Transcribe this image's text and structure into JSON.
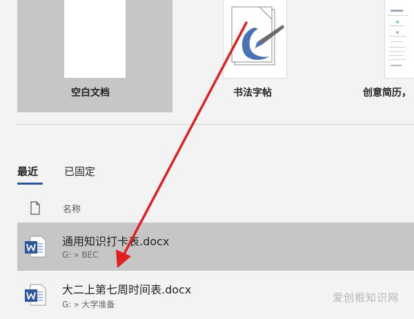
{
  "templates": {
    "blank": {
      "label": "空白文档"
    },
    "calligraphy": {
      "label": "书法字帖"
    },
    "resume": {
      "label": "创意简历，"
    }
  },
  "tabs": [
    {
      "label": "最近",
      "active": true
    },
    {
      "label": "已固定",
      "active": false
    }
  ],
  "file_list": {
    "column_name": "名称",
    "files": [
      {
        "name": "通用知识打卡表.docx",
        "path": "G: » BEC",
        "selected": true,
        "icon": "word-doc-icon"
      },
      {
        "name": "大二上第七周时间表.docx",
        "path": "G: » 大学准备",
        "selected": false,
        "icon": "word-doc-icon"
      }
    ]
  },
  "watermark": "爱创根知识网",
  "colors": {
    "word_blue": "#2b579a",
    "selected_row": "#c6c6c6",
    "annotation_arrow": "#e02020"
  }
}
